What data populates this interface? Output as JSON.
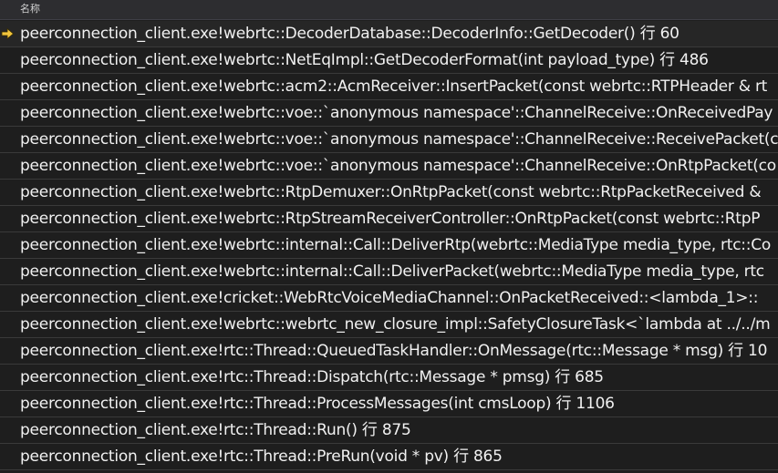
{
  "header": {
    "name_column": "名称"
  },
  "colors": {
    "background": "#1e1e1e",
    "text": "#f1f1f1",
    "current_frame_arrow": "#f2c53d"
  },
  "frames": [
    {
      "text": "peerconnection_client.exe!webrtc::DecoderDatabase::DecoderInfo::GetDecoder() 行 60",
      "current": true,
      "marker_icon": "current-frame-arrow-icon"
    },
    {
      "text": "peerconnection_client.exe!webrtc::NetEqImpl::GetDecoderFormat(int payload_type) 行 486",
      "current": false
    },
    {
      "text": "peerconnection_client.exe!webrtc::acm2::AcmReceiver::InsertPacket(const webrtc::RTPHeader & rt",
      "current": false
    },
    {
      "text": "peerconnection_client.exe!webrtc::voe::`anonymous namespace'::ChannelReceive::OnReceivedPay",
      "current": false
    },
    {
      "text": "peerconnection_client.exe!webrtc::voe::`anonymous namespace'::ChannelReceive::ReceivePacket(c",
      "current": false
    },
    {
      "text": "peerconnection_client.exe!webrtc::voe::`anonymous namespace'::ChannelReceive::OnRtpPacket(co",
      "current": false
    },
    {
      "text": "peerconnection_client.exe!webrtc::RtpDemuxer::OnRtpPacket(const webrtc::RtpPacketReceived &",
      "current": false
    },
    {
      "text": "peerconnection_client.exe!webrtc::RtpStreamReceiverController::OnRtpPacket(const webrtc::RtpP",
      "current": false
    },
    {
      "text": "peerconnection_client.exe!webrtc::internal::Call::DeliverRtp(webrtc::MediaType media_type, rtc::Co",
      "current": false
    },
    {
      "text": "peerconnection_client.exe!webrtc::internal::Call::DeliverPacket(webrtc::MediaType media_type, rtc",
      "current": false
    },
    {
      "text": "peerconnection_client.exe!cricket::WebRtcVoiceMediaChannel::OnPacketReceived::<lambda_1>::",
      "current": false
    },
    {
      "text": "peerconnection_client.exe!webrtc::webrtc_new_closure_impl::SafetyClosureTask<`lambda at ../../m",
      "current": false
    },
    {
      "text": "peerconnection_client.exe!rtc::Thread::QueuedTaskHandler::OnMessage(rtc::Message * msg) 行 10",
      "current": false
    },
    {
      "text": "peerconnection_client.exe!rtc::Thread::Dispatch(rtc::Message * pmsg) 行 685",
      "current": false
    },
    {
      "text": "peerconnection_client.exe!rtc::Thread::ProcessMessages(int cmsLoop) 行 1106",
      "current": false
    },
    {
      "text": "peerconnection_client.exe!rtc::Thread::Run() 行 875",
      "current": false
    },
    {
      "text": "peerconnection_client.exe!rtc::Thread::PreRun(void * pv) 行 865",
      "current": false
    }
  ]
}
